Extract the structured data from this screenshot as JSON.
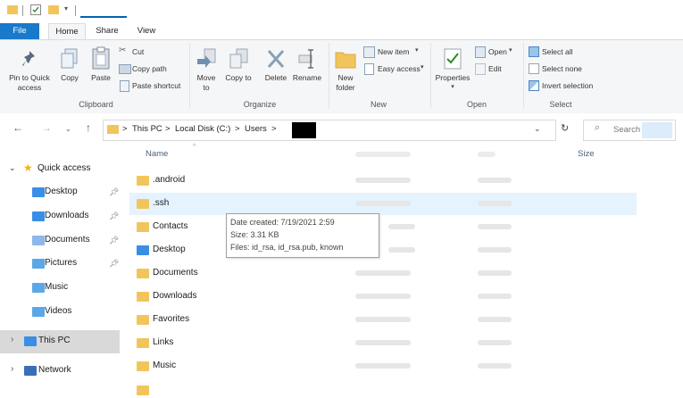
{
  "ribbon_tabs": [
    "File",
    "Home",
    "Share",
    "View"
  ],
  "clipboard": {
    "pin_quick_access": "Pin to Quick access",
    "copy": "Copy",
    "paste": "Paste",
    "cut": "Cut",
    "copy_path": "Copy path",
    "paste_shortcut": "Paste shortcut",
    "group": "Clipboard"
  },
  "organize": {
    "move_to": "Move to",
    "copy_to": "Copy to",
    "delete": "Delete",
    "rename": "Rename",
    "group": "Organize"
  },
  "new_group": {
    "new_folder": "New folder",
    "new_item": "New item",
    "easy_access": "Easy access",
    "group": "New"
  },
  "open_group": {
    "properties": "Properties",
    "open": "Open",
    "edit": "Edit",
    "group": "Open"
  },
  "select_group": {
    "select_all": "Select all",
    "select_none": "Select none",
    "invert_selection": "Invert selection",
    "group": "Select"
  },
  "address": {
    "this_pc": "This PC",
    "local_disk": "Local Disk (C:)",
    "users": "Users",
    "separator": ">"
  },
  "search": {
    "placeholder": "Search"
  },
  "columns": {
    "name": "Name",
    "size": "Size"
  },
  "nav": {
    "quick_access": "Quick access",
    "items": [
      "Desktop",
      "Downloads",
      "Documents",
      "Pictures",
      "Music",
      "Videos"
    ],
    "this_pc": "This PC",
    "network": "Network"
  },
  "files": [
    ".android",
    ".ssh",
    "Contacts",
    "Desktop",
    "Documents",
    "Downloads",
    "Favorites",
    "Links",
    "Music"
  ],
  "tooltip": {
    "date_created": "Date created: 7/19/2021 2:59",
    "size": "Size: 3.31 KB",
    "files": "Files: id_rsa, id_rsa.pub, known"
  },
  "colors": {
    "accent": "#1979ca",
    "folder": "#f2c55c",
    "selection": "#e5f3ff",
    "nav_selected": "#d9d9d9"
  }
}
